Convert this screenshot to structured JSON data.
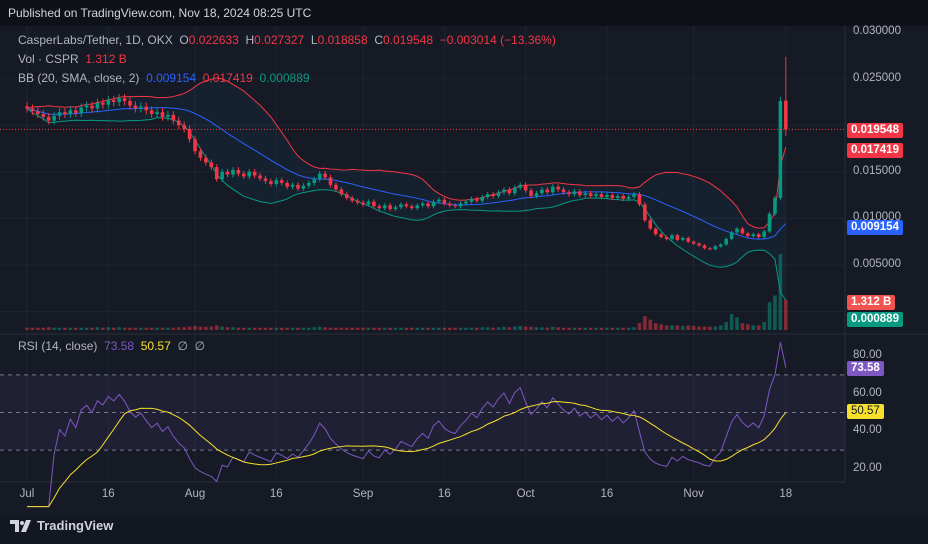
{
  "header": {
    "published": "Published on TradingView.com, Nov 18, 2024 08:25 UTC"
  },
  "legend": {
    "symbol": "CasperLabs/Tether, 1D, OKX",
    "o_label": "O",
    "o": "0.022633",
    "h_label": "H",
    "h": "0.027327",
    "l_label": "L",
    "l": "0.018858",
    "c_label": "C",
    "c": "0.019548",
    "change": "−0.003014 (−13.36%)",
    "vol_label": "Vol · CSPR",
    "vol": "1.312 B",
    "bb_label": "BB (20, SMA, close, 2)",
    "bb_basis": "0.009154",
    "bb_upper": "0.017419",
    "bb_lower": "0.000889",
    "rsi_label": "RSI (14, close)",
    "rsi": "73.58",
    "rsi_ma": "50.57",
    "rsi_extra1": "∅",
    "rsi_extra2": "∅"
  },
  "price_axis": [
    "0.030000",
    "0.025000",
    "0.015000",
    "0.010000",
    "0.005000"
  ],
  "price_ticks": [
    0.03,
    0.025,
    0.015,
    0.01,
    0.005
  ],
  "rsi_axis": [
    "80.00",
    "60.00",
    "40.00",
    "20.00"
  ],
  "rsi_ticks": [
    80,
    60,
    40,
    20
  ],
  "tags": {
    "last": "0.019548",
    "upper": "0.017419",
    "basis": "0.009154",
    "vol": "1.312 B",
    "lower": "0.000889",
    "rsi": "73.58",
    "rsi_ma": "50.57"
  },
  "time_axis": [
    {
      "label": "Jul",
      "day": 0
    },
    {
      "label": "16",
      "day": 15
    },
    {
      "label": "Aug",
      "day": 31
    },
    {
      "label": "16",
      "day": 46
    },
    {
      "label": "Sep",
      "day": 62
    },
    {
      "label": "16",
      "day": 77
    },
    {
      "label": "Oct",
      "day": 92
    },
    {
      "label": "16",
      "day": 107
    },
    {
      "label": "Nov",
      "day": 123
    },
    {
      "label": "18",
      "day": 140
    }
  ],
  "colors": {
    "up": "#089981",
    "down": "#f23645",
    "bb_basis": "#2962ff",
    "bb_upper": "#f23645",
    "bb_lower": "#089981",
    "rsi": "#7e57c2",
    "rsi_ma": "#f7e02c"
  },
  "brand": "TradingView",
  "chart_data": {
    "type": "candlestick",
    "first_date": "Jul 1",
    "last_date": "Nov 18",
    "last_candle": {
      "open": 0.022633,
      "high": 0.027327,
      "low": 0.018858,
      "close": 0.019548
    },
    "closes": [
      0.0218,
      0.0215,
      0.0212,
      0.0209,
      0.0205,
      0.021,
      0.0214,
      0.0212,
      0.0216,
      0.0213,
      0.0219,
      0.0221,
      0.0218,
      0.0224,
      0.0222,
      0.0227,
      0.0225,
      0.0229,
      0.0226,
      0.0221,
      0.0218,
      0.022,
      0.0216,
      0.0212,
      0.0214,
      0.0209,
      0.0211,
      0.0205,
      0.02,
      0.0196,
      0.0185,
      0.0172,
      0.0165,
      0.016,
      0.0155,
      0.0142,
      0.015,
      0.0147,
      0.0152,
      0.0148,
      0.0145,
      0.015,
      0.0146,
      0.0143,
      0.014,
      0.0137,
      0.0141,
      0.0138,
      0.0134,
      0.0136,
      0.0132,
      0.0135,
      0.0138,
      0.0142,
      0.0148,
      0.0144,
      0.0136,
      0.0131,
      0.0126,
      0.0122,
      0.0119,
      0.0117,
      0.0115,
      0.0118,
      0.0113,
      0.0111,
      0.0114,
      0.011,
      0.0112,
      0.0115,
      0.0113,
      0.0111,
      0.0114,
      0.0116,
      0.0113,
      0.0118,
      0.012,
      0.0116,
      0.0114,
      0.0113,
      0.0116,
      0.0118,
      0.0121,
      0.0119,
      0.0123,
      0.0126,
      0.0124,
      0.0128,
      0.0131,
      0.0127,
      0.0133,
      0.0136,
      0.013,
      0.0124,
      0.0127,
      0.0131,
      0.0128,
      0.0134,
      0.0131,
      0.0128,
      0.0126,
      0.0129,
      0.0125,
      0.0127,
      0.0124,
      0.0126,
      0.0123,
      0.0125,
      0.0122,
      0.0124,
      0.0121,
      0.0123,
      0.0126,
      0.0115,
      0.0098,
      0.0089,
      0.0083,
      0.008,
      0.0078,
      0.0082,
      0.0077,
      0.0079,
      0.0075,
      0.0073,
      0.0071,
      0.0068,
      0.0067,
      0.007,
      0.0072,
      0.0078,
      0.0085,
      0.0089,
      0.0084,
      0.0081,
      0.0083,
      0.008,
      0.0086,
      0.0105,
      0.0122,
      0.0226,
      0.019548
    ],
    "volumes_billions": [
      0.1,
      0.1,
      0.1,
      0.1,
      0.12,
      0.1,
      0.1,
      0.1,
      0.1,
      0.1,
      0.1,
      0.1,
      0.1,
      0.12,
      0.1,
      0.12,
      0.1,
      0.12,
      0.1,
      0.1,
      0.1,
      0.1,
      0.1,
      0.1,
      0.1,
      0.1,
      0.1,
      0.1,
      0.12,
      0.12,
      0.15,
      0.18,
      0.15,
      0.14,
      0.15,
      0.2,
      0.15,
      0.12,
      0.12,
      0.1,
      0.1,
      0.1,
      0.1,
      0.1,
      0.1,
      0.1,
      0.1,
      0.1,
      0.1,
      0.1,
      0.1,
      0.1,
      0.1,
      0.12,
      0.14,
      0.12,
      0.1,
      0.1,
      0.1,
      0.1,
      0.1,
      0.1,
      0.1,
      0.1,
      0.1,
      0.1,
      0.1,
      0.1,
      0.1,
      0.1,
      0.1,
      0.1,
      0.1,
      0.1,
      0.1,
      0.1,
      0.1,
      0.1,
      0.1,
      0.1,
      0.1,
      0.1,
      0.1,
      0.1,
      0.12,
      0.12,
      0.1,
      0.12,
      0.14,
      0.12,
      0.15,
      0.18,
      0.15,
      0.14,
      0.12,
      0.12,
      0.1,
      0.14,
      0.12,
      0.1,
      0.1,
      0.1,
      0.1,
      0.1,
      0.1,
      0.1,
      0.1,
      0.1,
      0.1,
      0.1,
      0.1,
      0.1,
      0.12,
      0.3,
      0.6,
      0.45,
      0.3,
      0.25,
      0.2,
      0.2,
      0.2,
      0.18,
      0.2,
      0.18,
      0.15,
      0.15,
      0.14,
      0.15,
      0.2,
      0.35,
      0.7,
      0.55,
      0.3,
      0.25,
      0.2,
      0.2,
      0.35,
      1.2,
      1.5,
      3.3,
      1.312
    ]
  }
}
